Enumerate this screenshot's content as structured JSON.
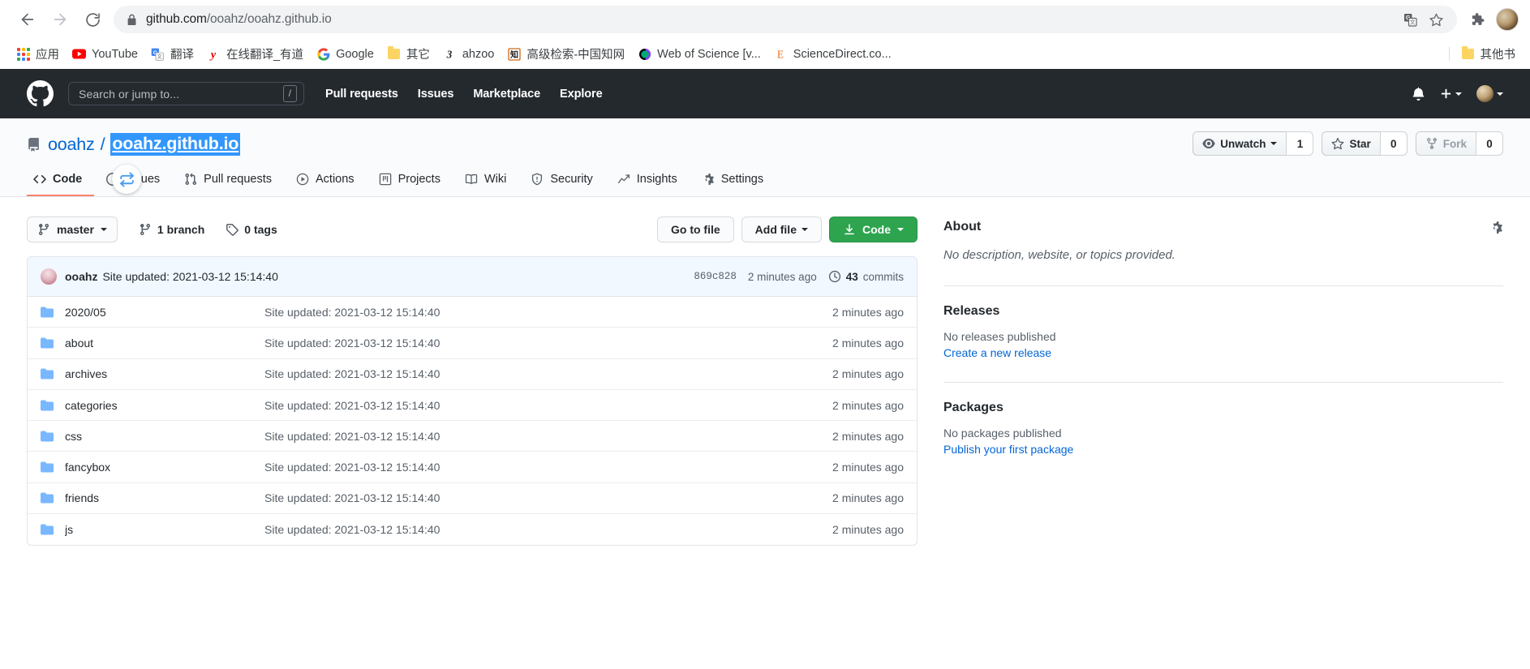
{
  "browser": {
    "back_label": "Back",
    "forward_label": "Forward",
    "reload_label": "Reload",
    "url_host": "github.com",
    "url_path": "/ooahz/ooahz.github.io",
    "translate_label": "Translate this page",
    "bookmark_label": "Bookmark this tab",
    "extensions_label": "Extensions",
    "profile_label": "Profile",
    "bookmarks": [
      {
        "label": "应用",
        "icon": "apps-grid-icon"
      },
      {
        "label": "YouTube",
        "icon": "youtube-icon"
      },
      {
        "label": "翻译",
        "icon": "google-translate-icon"
      },
      {
        "label": "在线翻译_有道",
        "icon": "youdao-icon"
      },
      {
        "label": "Google",
        "icon": "google-icon"
      },
      {
        "label": "其它",
        "icon": "folder-icon"
      },
      {
        "label": "ahzoo",
        "icon": "ahzoo-icon"
      },
      {
        "label": "高级检索-中国知网",
        "icon": "cnki-icon"
      },
      {
        "label": "Web of Science [v...",
        "icon": "web-of-science-icon"
      },
      {
        "label": "ScienceDirect.co...",
        "icon": "sciencedirect-icon"
      }
    ],
    "other_bookmarks": {
      "label": "其他书",
      "icon": "folder-icon"
    }
  },
  "gh_header": {
    "logo": "github-mark-icon",
    "search_placeholder": "Search or jump to...",
    "search_shortcut": "/",
    "nav": [
      {
        "label": "Pull requests"
      },
      {
        "label": "Issues"
      },
      {
        "label": "Marketplace"
      },
      {
        "label": "Explore"
      }
    ],
    "notifications_icon": "bell-icon",
    "create_new_icon": "plus-icon",
    "profile_icon": "avatar-icon"
  },
  "repo": {
    "owner": "ooahz",
    "separator": "/",
    "name": "ooahz.github.io",
    "repo_icon": "repo-book-icon",
    "actions": {
      "watch_label": "Unwatch",
      "watch_count": "1",
      "star_label": "Star",
      "star_count": "0",
      "fork_label": "Fork",
      "fork_count": "0"
    },
    "tabs": [
      {
        "label": "Code",
        "icon": "code-icon",
        "active": true
      },
      {
        "label": "Issues",
        "icon": "issue-opened-icon",
        "active": false
      },
      {
        "label": "Pull requests",
        "icon": "git-pull-request-icon",
        "active": false
      },
      {
        "label": "Actions",
        "icon": "play-circle-icon",
        "active": false
      },
      {
        "label": "Projects",
        "icon": "project-board-icon",
        "active": false
      },
      {
        "label": "Wiki",
        "icon": "book-icon",
        "active": false
      },
      {
        "label": "Security",
        "icon": "shield-icon",
        "active": false
      },
      {
        "label": "Insights",
        "icon": "graph-icon",
        "active": false
      },
      {
        "label": "Settings",
        "icon": "gear-icon",
        "active": false
      }
    ]
  },
  "toolbar": {
    "branch_name": "master",
    "branch_icon": "git-branch-icon",
    "branch_count": "1 branch",
    "tag_count": "0 tags",
    "tag_icon": "tag-icon",
    "go_to_file": "Go to file",
    "add_file": "Add file",
    "code_label": "Code",
    "code_icon": "download-icon"
  },
  "commit_bar": {
    "author": "ooahz",
    "message": "Site updated: 2021-03-12 15:14:40",
    "sha": "869c828",
    "relative_time": "2 minutes ago",
    "commits_count": "43",
    "commits_label": "commits",
    "history_icon": "history-icon"
  },
  "files": [
    {
      "name": "2020/05",
      "icon": "directory-icon",
      "message": "Site updated: 2021-03-12 15:14:40",
      "time": "2 minutes ago"
    },
    {
      "name": "about",
      "icon": "directory-icon",
      "message": "Site updated: 2021-03-12 15:14:40",
      "time": "2 minutes ago"
    },
    {
      "name": "archives",
      "icon": "directory-icon",
      "message": "Site updated: 2021-03-12 15:14:40",
      "time": "2 minutes ago"
    },
    {
      "name": "categories",
      "icon": "directory-icon",
      "message": "Site updated: 2021-03-12 15:14:40",
      "time": "2 minutes ago"
    },
    {
      "name": "css",
      "icon": "directory-icon",
      "message": "Site updated: 2021-03-12 15:14:40",
      "time": "2 minutes ago"
    },
    {
      "name": "fancybox",
      "icon": "directory-icon",
      "message": "Site updated: 2021-03-12 15:14:40",
      "time": "2 minutes ago"
    },
    {
      "name": "friends",
      "icon": "directory-icon",
      "message": "Site updated: 2021-03-12 15:14:40",
      "time": "2 minutes ago"
    },
    {
      "name": "js",
      "icon": "directory-icon",
      "message": "Site updated: 2021-03-12 15:14:40",
      "time": "2 minutes ago"
    }
  ],
  "sidebar": {
    "about_title": "About",
    "about_gear_icon": "gear-icon",
    "about_description": "No description, website, or topics provided.",
    "releases_title": "Releases",
    "releases_empty": "No releases published",
    "releases_link": "Create a new release",
    "packages_title": "Packages",
    "packages_empty": "No packages published",
    "packages_link": "Publish your first package"
  },
  "colors": {
    "gh_header_bg": "#24292e",
    "accent_green": "#2ea44f",
    "link_blue": "#0366d6",
    "selection_blue": "#3297fd",
    "active_tab_underline": "#f9826c",
    "commit_bar_bg": "#f1f8ff",
    "folder_icon": "#79b8ff"
  }
}
